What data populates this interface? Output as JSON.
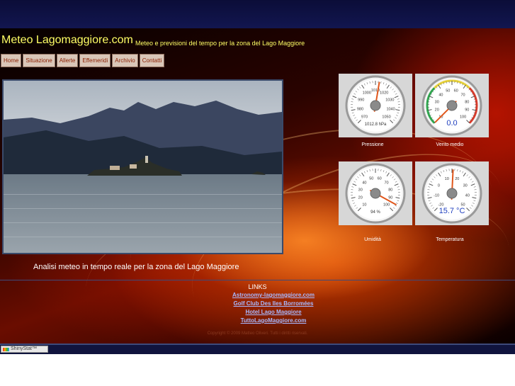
{
  "header": {
    "site_title": "Meteo Lagomaggiore.com",
    "tagline": "Meteo e previsioni del tempo per la zona del Lago Maggiore"
  },
  "nav": {
    "items": [
      "Home",
      "Situazione",
      "Allerte",
      "Effemeridi",
      "Archivio",
      "Contatti"
    ]
  },
  "main": {
    "caption": "Analisi meteo in tempo reale per la zona del Lago Maggiore"
  },
  "gauges": [
    {
      "label": "Pressione",
      "readout": "1012.8 hPa",
      "scale": [
        "970",
        "980",
        "990",
        "1000",
        "1010",
        "1020",
        "1030",
        "1040",
        "1050"
      ],
      "value": 1012.8,
      "min": 970,
      "max": 1050
    },
    {
      "label": "Vento medio",
      "readout": "0.0",
      "scale": [
        "10",
        "20",
        "30",
        "40",
        "50",
        "60",
        "70",
        "80",
        "90",
        "100"
      ],
      "value": 0.0,
      "min": 0,
      "max": 100
    },
    {
      "label": "Umidità",
      "readout": "94 %",
      "scale": [
        "10",
        "20",
        "30",
        "40",
        "50",
        "60",
        "70",
        "80",
        "90",
        "100"
      ],
      "value": 94,
      "min": 0,
      "max": 100
    },
    {
      "label": "Temperatura",
      "readout": "15.7 °C",
      "scale": [
        "-20",
        "-10",
        "0",
        "10",
        "20",
        "30",
        "40",
        "50"
      ],
      "value": 15.7,
      "min": -20,
      "max": 50
    }
  ],
  "links": {
    "title": "LINKS",
    "items": [
      "Astronomy-lagomaggiore.com",
      "Golf Club Des Iles Borromées",
      "Hotel Lago Maggiore",
      "TuttoLagoMaggiore.com"
    ]
  },
  "footer": {
    "copyright": "Copyright © 2009 Matteo Oliveri. Tutti i diritti riservati."
  },
  "badge": {
    "label": "ShinyStat™"
  },
  "colors": {
    "title_yellow": "#ffff66",
    "link_blue": "#a8b8ff",
    "nav_bg": "#d9c6b8",
    "band_navy": "#0b0d38"
  }
}
